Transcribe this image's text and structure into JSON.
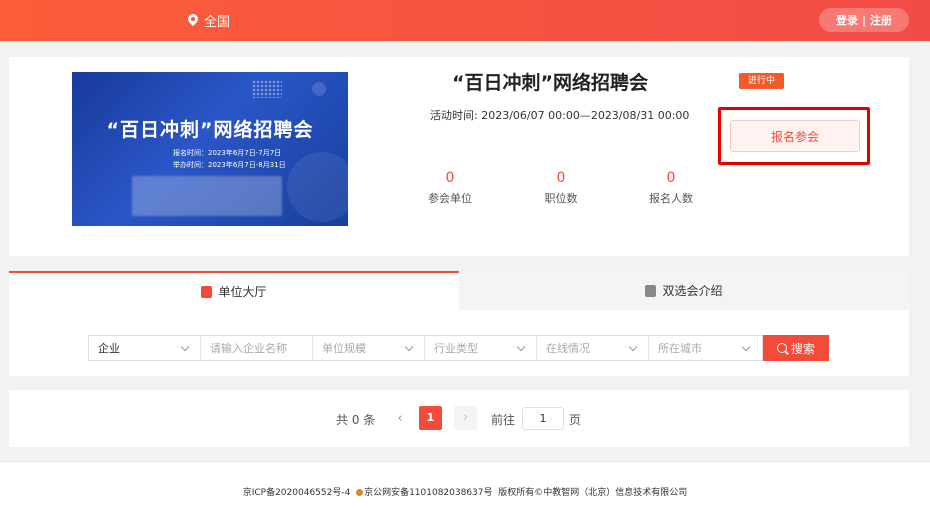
{
  "header": {
    "location": "全国",
    "login": "登录",
    "separator": "|",
    "register": "注册"
  },
  "banner": {
    "title": "“百日冲刺”网络招聘会",
    "line1": "报名时间：2023年6月7日-7月7日",
    "line2": "举办时间：2023年6月7日-8月31日"
  },
  "event": {
    "title": "“百日冲刺”网络招聘会",
    "status": "进行中",
    "time_label": "活动时间:",
    "time_value": "2023/06/07 00:00—2023/08/31 00:00",
    "signup_button": "报名参会",
    "stats": [
      {
        "value": "0",
        "label": "参会单位"
      },
      {
        "value": "0",
        "label": "职位数"
      },
      {
        "value": "0",
        "label": "报名人数"
      }
    ]
  },
  "tabs": [
    {
      "label": "单位大厅",
      "icon": "building-icon"
    },
    {
      "label": "双选会介绍",
      "icon": "book-icon"
    }
  ],
  "filters": {
    "type_value": "企业",
    "name_placeholder": "请输入企业名称",
    "scale_placeholder": "单位规模",
    "industry_placeholder": "行业类型",
    "online_placeholder": "在线情况",
    "city_placeholder": "所在城市",
    "search_button": "搜索"
  },
  "pagination": {
    "total": "共 0 条",
    "prev": "‹",
    "current": "1",
    "next": "›",
    "goto_label": "前往",
    "page_input": "1",
    "page_unit": "页"
  },
  "footer": {
    "icp": "京ICP备2020046552号-4",
    "police": "京公网安备1101082038637号",
    "copyright": "版权所有©中教智网（北京）信息技术有限公司"
  },
  "colors": {
    "brand": "#f24b3a",
    "highlight_box": "#e50000",
    "banner_blue": "#2a56c7"
  }
}
